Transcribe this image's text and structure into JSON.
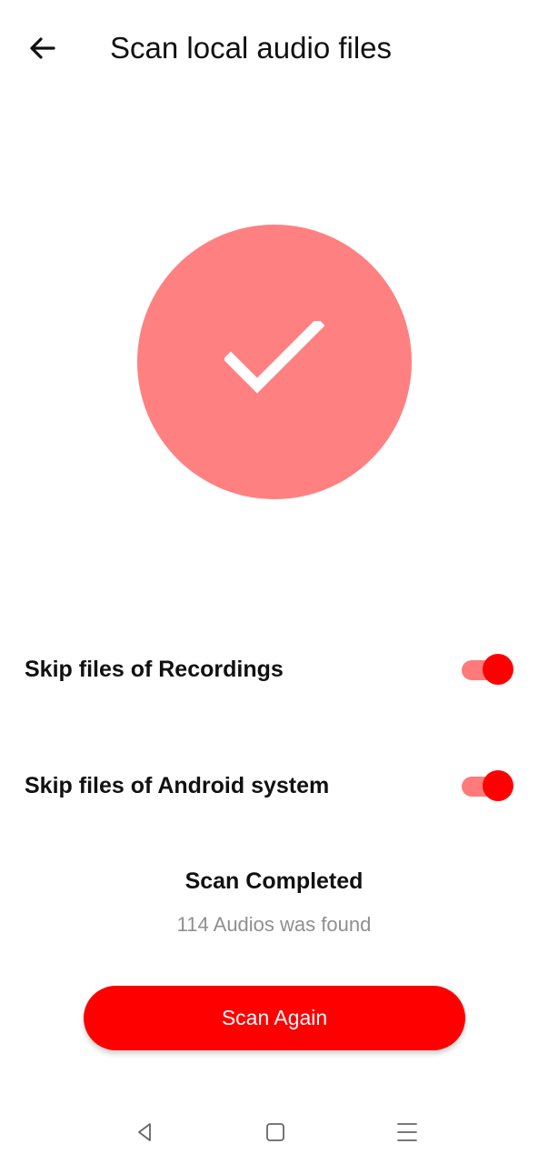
{
  "header": {
    "back_icon": "arrow-left-icon",
    "title": "Scan local audio files"
  },
  "status_circle": {
    "icon": "checkmark-icon",
    "color": "#ff8080"
  },
  "settings": {
    "skip_recordings": {
      "label": "Skip files of Recordings",
      "enabled": true
    },
    "skip_android_system": {
      "label": "Skip files of Android system",
      "enabled": true
    }
  },
  "scan": {
    "status": "Scan Completed",
    "result": "114 Audios was found",
    "button_label": "Scan Again"
  },
  "colors": {
    "accent": "#ff0000",
    "accent_light": "#ff7a7a",
    "circle": "#ff8080",
    "muted_text": "#8f8f8f"
  },
  "navigation_bar": {
    "back_icon": "triangle-back-icon",
    "home_icon": "square-home-icon",
    "menu_icon": "menu-lines-icon"
  }
}
